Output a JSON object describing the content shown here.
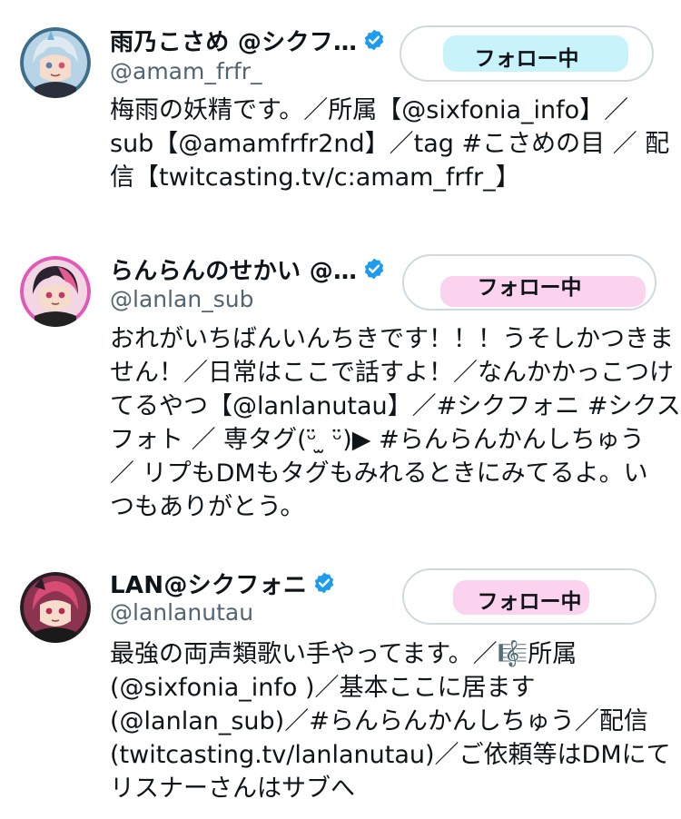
{
  "users": [
    {
      "display_name": "雨乃こさめ @シクフ…",
      "handle": "@amam_frfr_",
      "follow_label": "フォロー中",
      "highlight_color": "#c9f3fb",
      "bio_lines": [
        "梅雨の妖精です。／所属【@sixfonia_info】／",
        "sub【@amamfrfr2nd】／tag #こさめの目 ／ 配",
        "信【twitcasting.tv/c:amam_frfr_】"
      ]
    },
    {
      "display_name": "らんらんのせかい @…",
      "handle": "@lanlan_sub",
      "follow_label": "フォロー中",
      "highlight_color": "#fbd3ef",
      "bio_lines": [
        "おれがいちばんいんちきです！！！うそしかつきま",
        "せん！／日常はここで話すよ！／なんかかっこつけ",
        "てるやつ【@lanlanutau】／#シクフォニ #シクス",
        "フォト ／ 専タグ(ᵕ̈ ̫ ᵕ̈)▶ #らんらんかんしちゅう",
        "／ リプもDMもタグもみれるときにみてるよ。い",
        "つもありがとう。"
      ]
    },
    {
      "display_name": "LAN@シクフォニ",
      "handle": "@lanlanutau",
      "follow_label": "フォロー中",
      "highlight_color": "#fbd3ef",
      "bio_lines": [
        "最強の両声類歌い手やってます。／🎼所属",
        "(@sixfonia_info )／基本ここに居ます",
        "(@lanlan_sub)／#らんらんかんしちゅう／配信",
        "(twitcasting.tv/lanlanutau)／ご依頼等はDMにて",
        "リスナーさんはサブへ"
      ]
    }
  ],
  "icons": {
    "verified": "verified-badge-icon",
    "verified_color": "#1d9bf0"
  }
}
